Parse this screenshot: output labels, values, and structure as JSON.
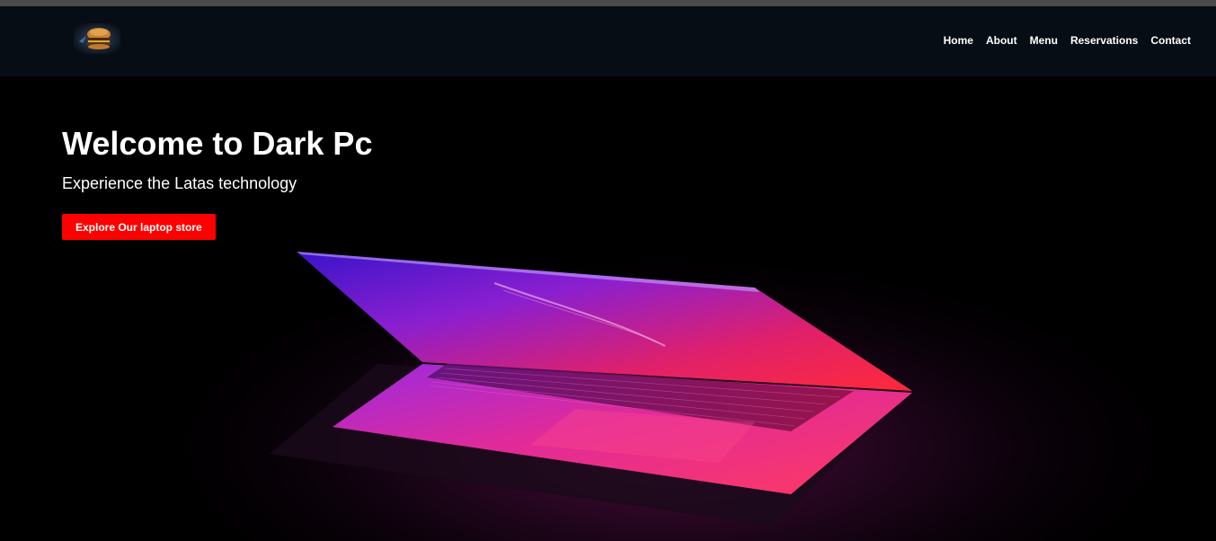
{
  "nav": {
    "logo_icon": "burger-logo-icon",
    "links": [
      "Home",
      "About",
      "Menu",
      "Reservations",
      "Contact"
    ]
  },
  "hero": {
    "title": "Welcome to Dark Pc",
    "subtitle": "Experience the Latas technology",
    "cta_label": "Explore Our laptop store",
    "image_icon": "glowing-laptop-image"
  },
  "colors": {
    "top_strip": "#4a4a4a",
    "navbar_bg": "#070d14",
    "hero_bg": "#000000",
    "cta_bg": "#ff0000",
    "text": "#ffffff",
    "glow_pink": "#ff2a6d",
    "glow_purple": "#7a1bd6"
  }
}
